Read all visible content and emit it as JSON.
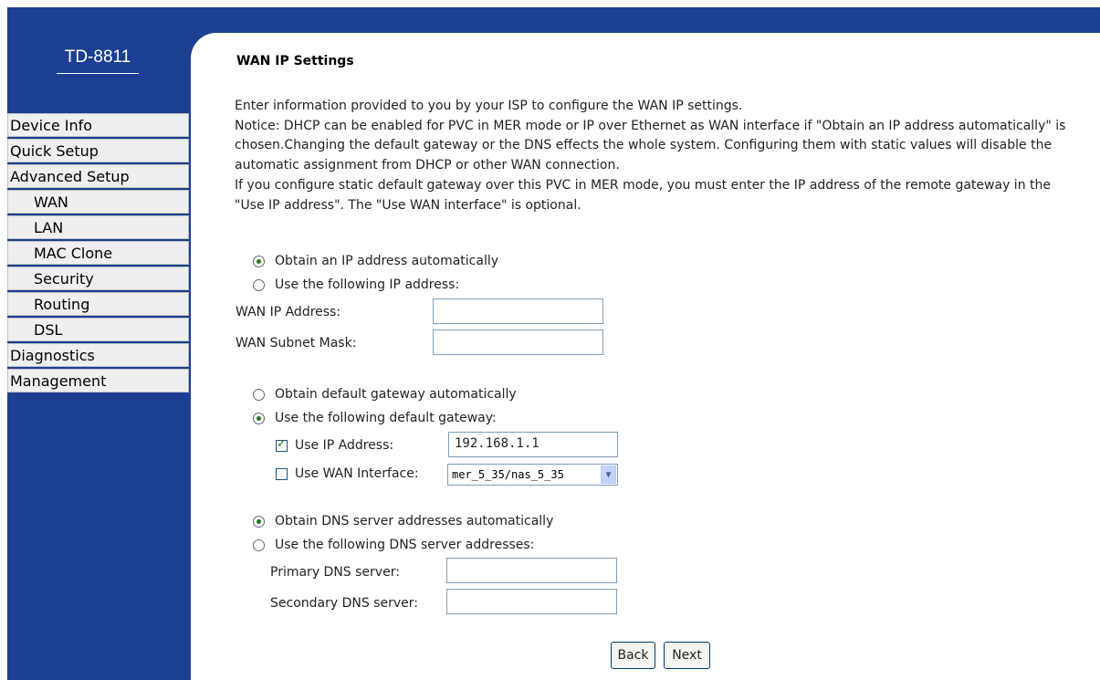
{
  "sidebar": {
    "logo": "TD-8811",
    "items": [
      {
        "label": "Device Info"
      },
      {
        "label": "Quick Setup"
      },
      {
        "label": "Advanced Setup"
      },
      {
        "label": "WAN"
      },
      {
        "label": "LAN"
      },
      {
        "label": "MAC Clone"
      },
      {
        "label": "Security"
      },
      {
        "label": "Routing"
      },
      {
        "label": "DSL"
      },
      {
        "label": "Diagnostics"
      },
      {
        "label": "Management"
      }
    ]
  },
  "main": {
    "title": "WAN IP Settings",
    "description": [
      "Enter information provided to you by your ISP to configure the WAN IP settings.",
      "Notice: DHCP can be enabled for PVC in MER mode or IP over Ethernet as WAN interface if \"Obtain an IP address automatically\" is chosen.Changing the default gateway or the DNS effects the whole system. Configuring them with static values will disable the automatic assignment from DHCP or other WAN connection.",
      "If you configure static default gateway over this PVC in MER mode, you must enter the IP address of the remote gateway in the \"Use IP address\". The \"Use WAN interface\" is optional."
    ],
    "ip": {
      "auto_label": "Obtain an IP address automatically",
      "manual_label": "Use the following IP address:",
      "wan_ip_label": "WAN IP Address:",
      "wan_ip_value": "",
      "mask_label": "WAN Subnet Mask:",
      "mask_value": ""
    },
    "gateway": {
      "auto_label": "Obtain default gateway automatically",
      "manual_label": "Use the following default gateway:",
      "use_ip_label": "Use IP Address:",
      "use_ip_value": "192.168.1.1",
      "use_wan_label": "Use WAN Interface:",
      "use_wan_value": "mer_5_35/nas_5_35"
    },
    "dns": {
      "auto_label": "Obtain DNS server addresses automatically",
      "manual_label": "Use the following DNS server addresses:",
      "primary_label": "Primary DNS server:",
      "primary_value": "",
      "secondary_label": "Secondary DNS server:",
      "secondary_value": ""
    },
    "buttons": {
      "back": "Back",
      "next": "Next"
    }
  }
}
